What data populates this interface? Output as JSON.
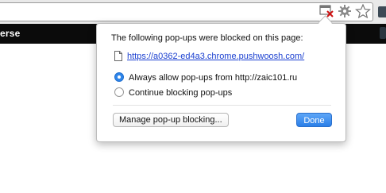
{
  "browser": {
    "icons": [
      "popup-blocked-icon",
      "gear-icon",
      "star-icon"
    ]
  },
  "page": {
    "toolbar_text": "erse"
  },
  "bubble": {
    "title": "The following pop-ups were blocked on this page:",
    "blocked_link": "https://a0362-ed4a3.chrome.pushwoosh.com/",
    "options": [
      {
        "label": "Always allow pop-ups from http://zaic101.ru",
        "selected": true
      },
      {
        "label": "Continue blocking pop-ups",
        "selected": false
      }
    ],
    "manage_button": "Manage pop-up blocking...",
    "done_button": "Done"
  },
  "colors": {
    "accent": "#2f86ea",
    "link": "#1a3fd0",
    "blocked_icon_x": "#cc1111"
  }
}
